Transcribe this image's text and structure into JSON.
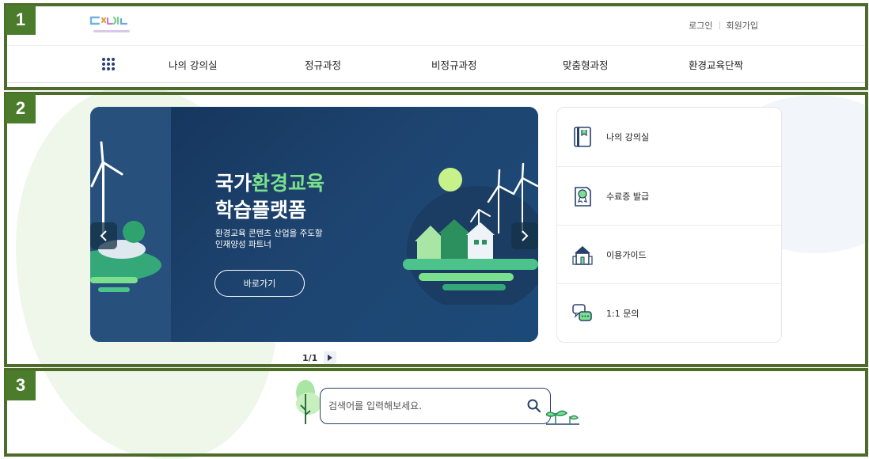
{
  "header": {
    "login_label": "로그인",
    "signup_label": "회원가입",
    "nav": {
      "menu_icon": "grid-dots-icon",
      "items": [
        {
          "label": "나의 강의실"
        },
        {
          "label": "정규과정"
        },
        {
          "label": "비정규과정"
        },
        {
          "label": "맞춤형과정"
        },
        {
          "label": "환경교육단짝"
        }
      ]
    }
  },
  "banner": {
    "title_prefix": "국가",
    "title_highlight": "환경교육",
    "title_line2": "학습플랫폼",
    "subtitle_line1": "환경교육 콘텐츠 산업을 주도할",
    "subtitle_line2": "인재양성 파트너",
    "button_label": "바로가기",
    "pager_current": "1",
    "pager_total": "1",
    "pager_text": "1/1"
  },
  "quick_menu": {
    "items": [
      {
        "label": "나의 강의실",
        "icon": "book-icon"
      },
      {
        "label": "수료증 발급",
        "icon": "certificate-icon"
      },
      {
        "label": "이용가이드",
        "icon": "building-icon"
      },
      {
        "label": "1:1 문의",
        "icon": "chat-icon"
      }
    ]
  },
  "search": {
    "placeholder": "검색어를 입력해보세요."
  },
  "sections": {
    "labels": [
      "1",
      "2",
      "3"
    ]
  },
  "colors": {
    "accent_green": "#4a7c2c",
    "banner_navy": "#1d3f6d",
    "highlight_green": "#7be08d",
    "search_border": "#26406b"
  }
}
